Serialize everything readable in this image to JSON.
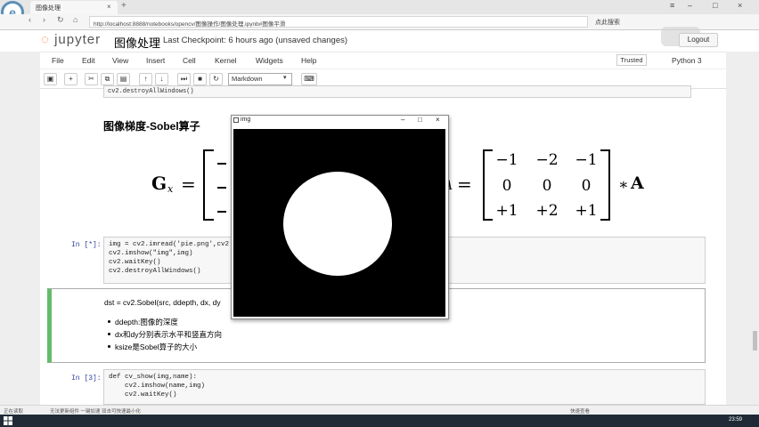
{
  "browser": {
    "tab_title": "图像处理",
    "url": "http://localhost:8888/notebooks/opencv/图像操作/图像处理.ipynb#图像平滑",
    "search_label": "点此搜索"
  },
  "jupyter": {
    "logo_text": "jupyter",
    "notebook_title": "图像处理",
    "checkpoint": "Last Checkpoint: 6 hours ago (unsaved changes)",
    "logout": "Logout",
    "trusted": "Trusted",
    "kernel": "Python 3"
  },
  "menu": [
    "File",
    "Edit",
    "View",
    "Insert",
    "Cell",
    "Kernel",
    "Widgets",
    "Help"
  ],
  "toolbar": {
    "cell_type": "Markdown"
  },
  "cells": {
    "prev_code": "cv2.destroyAllWindows()",
    "heading": "图像梯度-Sobel算子",
    "formula": {
      "lhs": "G",
      "sub": "x",
      "eq": "=",
      "rhs_fragment": "A",
      "matrix": [
        [
          "−1",
          "−2",
          "−1"
        ],
        [
          "0",
          "0",
          "0"
        ],
        [
          "+1",
          "+2",
          "+1"
        ]
      ],
      "star": "∗",
      "A": "A"
    },
    "code1_prompt": "In [*]:",
    "code1_lines": [
      "img = cv2.imread('pie.png',cv2",
      "cv2.imshow(\"img\",img)",
      "cv2.waitKey()",
      "cv2.destroyAllWindows()"
    ],
    "md_sobel": "dst = cv2.Sobel(src, ddepth, dx, dy",
    "bullets": [
      "ddepth:图像的深度",
      "dx和dy分别表示水平和竖直方向",
      "ksize是Sobel算子的大小"
    ],
    "code2_prompt": "In [3]:",
    "code2_lines": [
      "def cv_show(img,name):",
      "    cv2.imshow(name,img)",
      "    cv2.waitKey()"
    ]
  },
  "cv_window": {
    "title": "img"
  },
  "status": {
    "left": "正在读取",
    "hint": "无法更新组件 一键加速   双击可快速最小化",
    "right": "快速查看",
    "time": "23:59"
  }
}
